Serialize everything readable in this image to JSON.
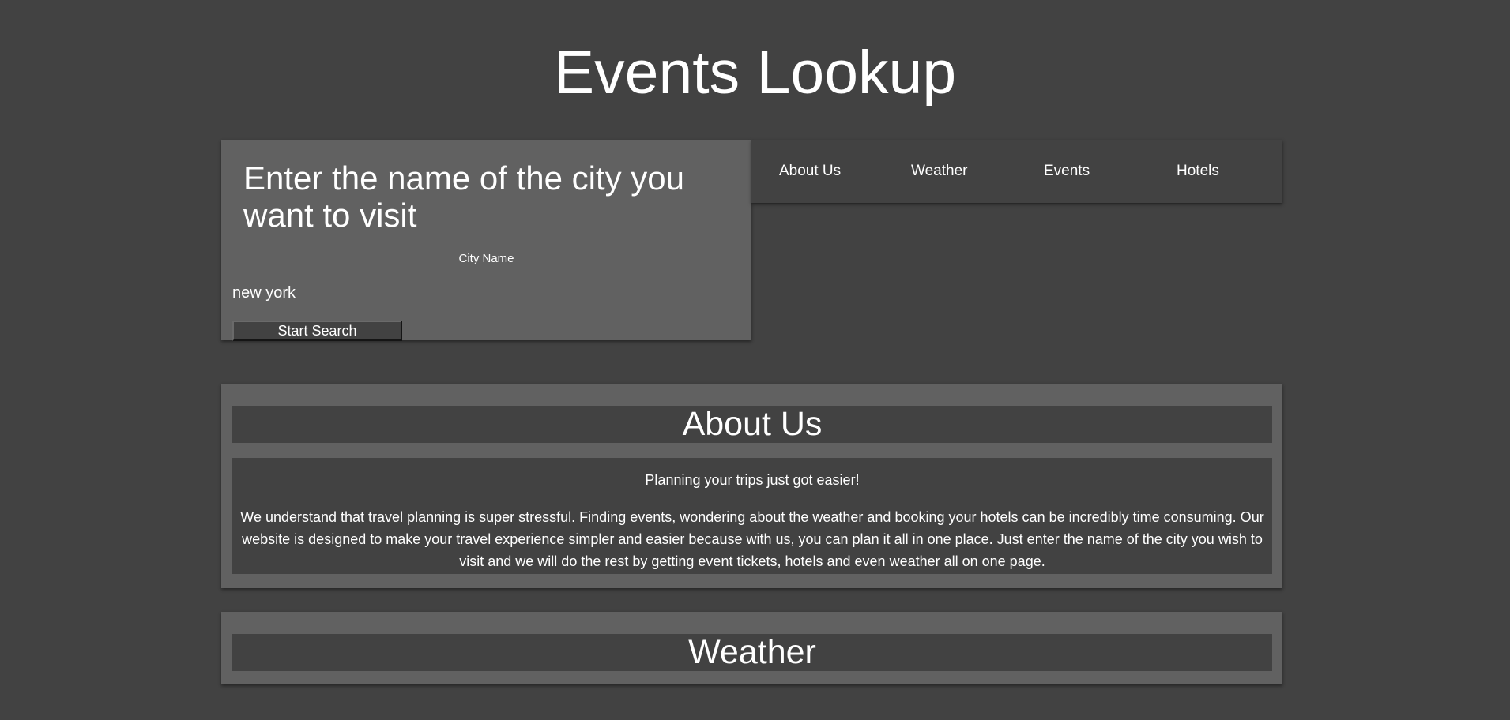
{
  "page": {
    "title": "Events Lookup"
  },
  "search": {
    "heading": "Enter the name of the city you want to visit",
    "label": "City Name",
    "value": "new york",
    "button_label": "Start Search"
  },
  "nav": {
    "items": [
      {
        "label": "About Us"
      },
      {
        "label": "Weather"
      },
      {
        "label": "Events"
      },
      {
        "label": "Hotels"
      }
    ]
  },
  "about": {
    "title": "About Us",
    "tagline": "Planning your trips just got easier!",
    "description": "We understand that travel planning is super stressful. Finding events, wondering about the weather and booking your hotels can be incredibly time consuming. Our website is designed to make your travel experience simpler and easier because with us, you can plan it all in one place. Just enter the name of the city you wish to visit and we will do the rest by getting event tickets, hotels and even weather all on one page."
  },
  "weather": {
    "title": "Weather"
  },
  "colors": {
    "background": "#424242",
    "card": "#616161",
    "text": "#ffffff"
  }
}
